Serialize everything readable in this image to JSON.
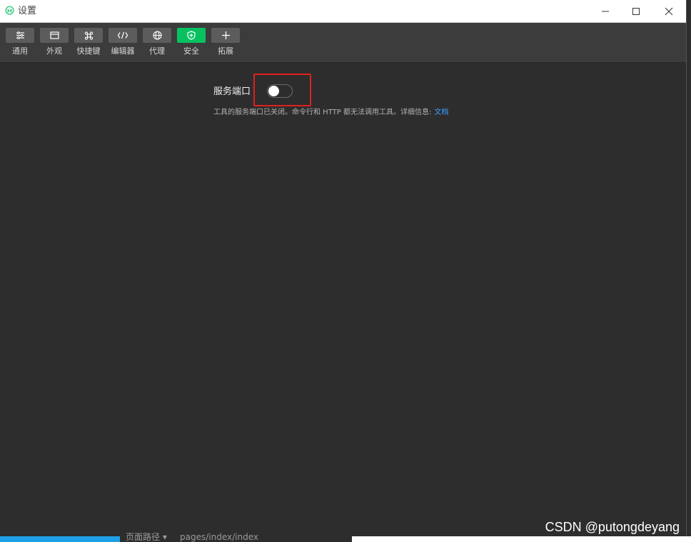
{
  "window": {
    "title": "设置"
  },
  "toolbar": {
    "items": [
      {
        "label": "通用",
        "icon": "list-settings-icon"
      },
      {
        "label": "外观",
        "icon": "window-layout-icon"
      },
      {
        "label": "快捷键",
        "icon": "command-key-icon"
      },
      {
        "label": "编辑器",
        "icon": "code-icon"
      },
      {
        "label": "代理",
        "icon": "globe-icon"
      },
      {
        "label": "安全",
        "icon": "shield-icon",
        "active": true
      },
      {
        "label": "拓展",
        "icon": "plus-icon"
      }
    ],
    "active_color": "#07c160"
  },
  "security": {
    "service_port_label": "服务端口",
    "service_port_enabled": false,
    "description": "工具的服务端口已关闭。命令行和 HTTP 都无法调用工具。详细信息:",
    "doc_link": "文档",
    "link_color": "#3aa0ff",
    "highlight_color": "#e02020"
  },
  "background_window": {
    "fragment_1": "页面路径 ▾",
    "fragment_2": "pages/index/index"
  },
  "watermark": "CSDN @putongdeyang"
}
